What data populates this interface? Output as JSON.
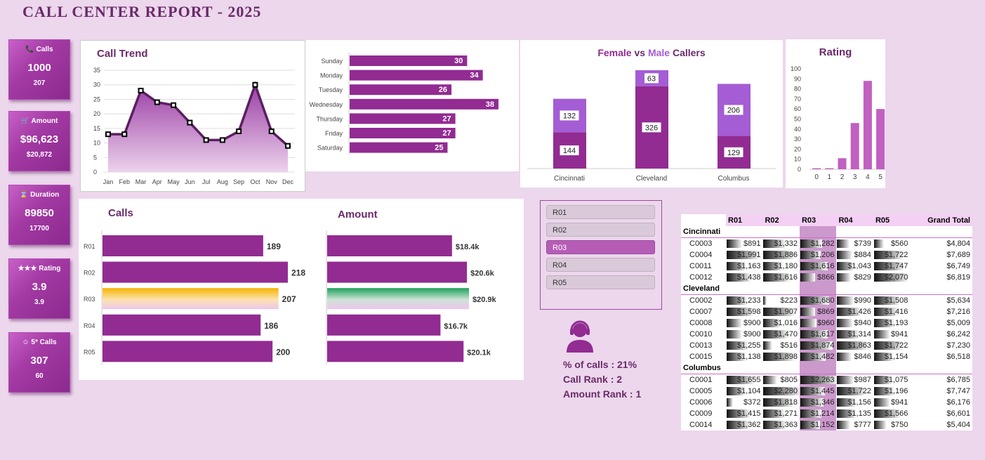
{
  "title": "CALL CENTER REPORT - 2025",
  "kpis": [
    {
      "label": "Calls",
      "icon": "phone-icon",
      "glyph": "📞",
      "value": "1000",
      "sub": "207"
    },
    {
      "label": "Amount",
      "icon": "cart-icon",
      "glyph": "🛒",
      "value": "$96,623",
      "sub": "$20,872"
    },
    {
      "label": "Duration",
      "icon": "hourglass-icon",
      "glyph": "⌛",
      "value": "89850",
      "sub": "17700"
    },
    {
      "label": "Rating",
      "icon": "stars-icon",
      "glyph": "★★★",
      "value": "3.9",
      "sub": "3.9"
    },
    {
      "label": "5* Calls",
      "icon": "smiley-icon",
      "glyph": "☺",
      "value": "307",
      "sub": "60"
    }
  ],
  "call_trend": {
    "title": "Call Trend",
    "months": [
      "Jan",
      "Feb",
      "Mar",
      "Apr",
      "May",
      "Jun",
      "Jul",
      "Aug",
      "Sep",
      "Oct",
      "Nov",
      "Dec"
    ],
    "values": [
      13,
      13,
      28,
      24,
      23,
      17,
      11,
      11,
      14,
      30,
      14,
      9
    ],
    "yticks": [
      0,
      5,
      10,
      15,
      20,
      25,
      30,
      35
    ]
  },
  "weekday": {
    "days": [
      "Sunday",
      "Monday",
      "Tuesday",
      "Wednesday",
      "Thursday",
      "Friday",
      "Saturday"
    ],
    "values": [
      30,
      34,
      26,
      38,
      27,
      27,
      25
    ]
  },
  "gender": {
    "title_female": "Female",
    "title_vs": " vs ",
    "title_male": "Male",
    "title_callers": " Callers",
    "cities": [
      "Cincinnati",
      "Cleveland",
      "Columbus"
    ],
    "bottom": [
      144,
      326,
      129
    ],
    "top": [
      132,
      63,
      206
    ]
  },
  "rating": {
    "title": "Rating",
    "cats": [
      "0",
      "1",
      "2",
      "3",
      "4",
      "5"
    ],
    "values": [
      1,
      1,
      11,
      46,
      88,
      60
    ],
    "yticks": [
      0,
      10,
      20,
      30,
      40,
      50,
      60,
      70,
      80,
      90,
      100
    ]
  },
  "calls_rep": {
    "title": "Calls",
    "reps": [
      "R01",
      "R02",
      "R03",
      "R04",
      "R05"
    ],
    "values": [
      189,
      218,
      207,
      186,
      200
    ],
    "labels": [
      "189",
      "218",
      "207",
      "186",
      "200"
    ]
  },
  "amount_rep": {
    "title": "Amount",
    "values": [
      18.4,
      20.6,
      20.9,
      16.7,
      20.1
    ],
    "labels": [
      "$18.4k",
      "$20.6k",
      "$20.9k",
      "$16.7k",
      "$20.1k"
    ]
  },
  "slicer": {
    "items": [
      "R01",
      "R02",
      "R03",
      "R04",
      "R05"
    ],
    "selected": "R03"
  },
  "rep_info": {
    "pct": "% of calls : 21%",
    "call_rank": "Call Rank : 2",
    "amount_rank": "Amount Rank : 1"
  },
  "table": {
    "headers": [
      "R01",
      "R02",
      "R03",
      "R04",
      "R05",
      "Grand Total"
    ],
    "groups": [
      {
        "city": "Cincinnati",
        "rows": [
          [
            "C0003",
            "$891",
            "$1,332",
            "$1,282",
            "$739",
            "$560",
            "$4,804"
          ],
          [
            "C0004",
            "$1,991",
            "$1,886",
            "$1,206",
            "$884",
            "$1,722",
            "$7,689"
          ],
          [
            "C0011",
            "$1,163",
            "$1,180",
            "$1,616",
            "$1,043",
            "$1,747",
            "$6,749"
          ],
          [
            "C0012",
            "$1,438",
            "$1,616",
            "$866",
            "$829",
            "$2,070",
            "$6,819"
          ]
        ]
      },
      {
        "city": "Cleveland",
        "rows": [
          [
            "C0002",
            "$1,233",
            "$223",
            "$1,680",
            "$990",
            "$1,508",
            "$5,634"
          ],
          [
            "C0007",
            "$1,598",
            "$1,907",
            "$869",
            "$1,426",
            "$1,416",
            "$7,216"
          ],
          [
            "C0008",
            "$900",
            "$1,016",
            "$960",
            "$940",
            "$1,193",
            "$5,009"
          ],
          [
            "C0010",
            "$900",
            "$1,470",
            "$1,617",
            "$1,314",
            "$941",
            "$6,242"
          ],
          [
            "C0013",
            "$1,255",
            "$516",
            "$1,874",
            "$1,863",
            "$1,722",
            "$7,230"
          ],
          [
            "C0015",
            "$1,138",
            "$1,898",
            "$1,482",
            "$846",
            "$1,154",
            "$6,518"
          ]
        ]
      },
      {
        "city": "Columbus",
        "rows": [
          [
            "C0001",
            "$1,655",
            "$805",
            "$2,263",
            "$987",
            "$1,075",
            "$6,785"
          ],
          [
            "C0005",
            "$1,104",
            "$2,280",
            "$1,445",
            "$1,722",
            "$1,196",
            "$7,747"
          ],
          [
            "C0006",
            "$372",
            "$1,818",
            "$1,346",
            "$1,156",
            "$941",
            "$6,176"
          ],
          [
            "C0009",
            "$1,415",
            "$1,271",
            "$1,214",
            "$1,135",
            "$1,566",
            "$6,601"
          ],
          [
            "C0014",
            "$1,362",
            "$1,363",
            "$1,152",
            "$777",
            "$750",
            "$5,404"
          ]
        ]
      }
    ]
  },
  "colors": {
    "purple": "#922b92",
    "light": "#a45dd4",
    "orange": "#f5b400",
    "green": "#1fa05a"
  }
}
